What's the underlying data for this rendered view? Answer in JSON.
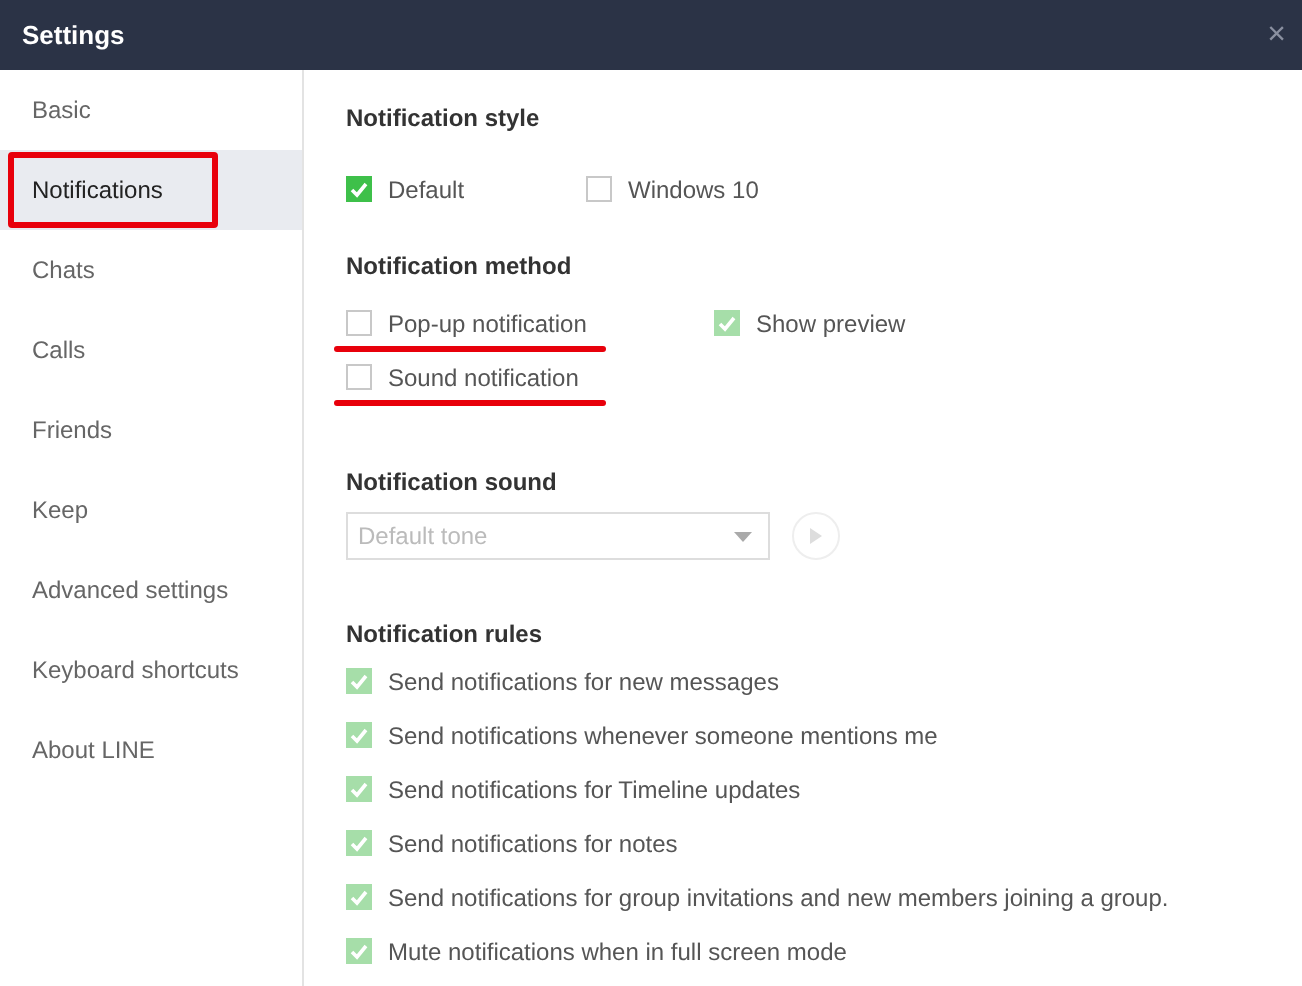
{
  "window": {
    "title": "Settings",
    "close": "×"
  },
  "sidebar": {
    "items": [
      {
        "label": "Basic",
        "selected": false,
        "annotated": false
      },
      {
        "label": "Notifications",
        "selected": true,
        "annotated": true
      },
      {
        "label": "Chats",
        "selected": false,
        "annotated": false
      },
      {
        "label": "Calls",
        "selected": false,
        "annotated": false
      },
      {
        "label": "Friends",
        "selected": false,
        "annotated": false
      },
      {
        "label": "Keep",
        "selected": false,
        "annotated": false
      },
      {
        "label": "Advanced settings",
        "selected": false,
        "annotated": false
      },
      {
        "label": "Keyboard shortcuts",
        "selected": false,
        "annotated": false
      },
      {
        "label": "About LINE",
        "selected": false,
        "annotated": false
      }
    ]
  },
  "style": {
    "heading": "Notification style",
    "options": [
      {
        "label": "Default",
        "checked": true,
        "disabled": false,
        "annotated": false
      },
      {
        "label": "Windows 10",
        "checked": false,
        "disabled": false,
        "annotated": false
      }
    ]
  },
  "method": {
    "heading": "Notification method",
    "options": [
      {
        "label": "Pop-up notification",
        "checked": false,
        "disabled": false,
        "annotated": true
      },
      {
        "label": "Show preview",
        "checked": true,
        "disabled": true,
        "annotated": false
      },
      {
        "label": "Sound notification",
        "checked": false,
        "disabled": false,
        "annotated": true
      }
    ]
  },
  "sound": {
    "heading": "Notification sound",
    "dropdown": {
      "value": "Default tone",
      "disabled": true
    }
  },
  "rules": {
    "heading": "Notification rules",
    "options": [
      {
        "label": "Send notifications for new messages",
        "checked": true,
        "disabled": true,
        "annotated": false
      },
      {
        "label": "Send notifications whenever someone mentions me",
        "checked": true,
        "disabled": true,
        "annotated": false
      },
      {
        "label": "Send notifications for Timeline updates",
        "checked": true,
        "disabled": true,
        "annotated": false
      },
      {
        "label": "Send notifications for notes",
        "checked": true,
        "disabled": true,
        "annotated": false
      },
      {
        "label": "Send notifications for group invitations and new members joining a group.",
        "checked": true,
        "disabled": true,
        "annotated": false
      },
      {
        "label": "Mute notifications when in full screen mode",
        "checked": true,
        "disabled": true,
        "annotated": false
      }
    ]
  }
}
